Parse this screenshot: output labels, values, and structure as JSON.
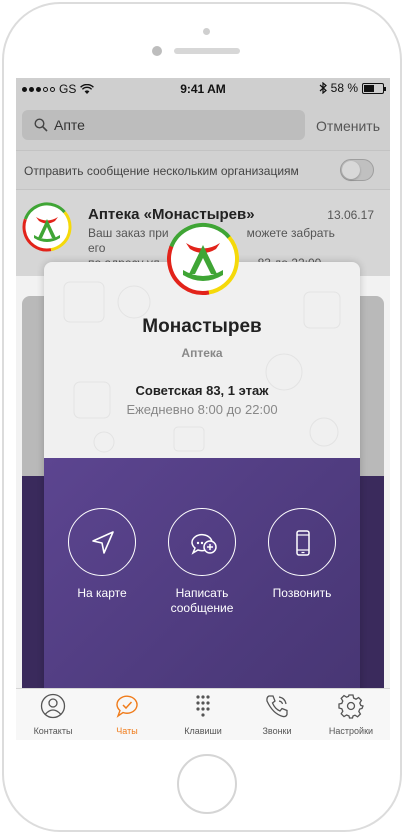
{
  "status_bar": {
    "carrier": "GS",
    "time": "9:41 AM",
    "battery": "58 %",
    "battery_level": 0.58
  },
  "search": {
    "value": "Апте",
    "cancel_label": "Отменить"
  },
  "broadcast": {
    "label": "Отправить сообщение нескольким организациям",
    "enabled": false
  },
  "chat": {
    "name": "Аптека «Монастырев»",
    "date": "13.06.17",
    "preview_line1": "Ваш заказ при",
    "preview_line1_end": "можете забрать его",
    "preview_line2": "по адресу ул",
    "preview_line2_end": "83 до 22:00..."
  },
  "card": {
    "title": "Монастырев",
    "subtitle": "Аптека",
    "address": "Советская 83, 1 этаж",
    "hours": "Ежедневно 8:00 до 22:00",
    "actions": [
      {
        "label": "На карте",
        "icon": "navigation-arrow-icon"
      },
      {
        "label": "Написать сообщение",
        "label_line1": "Написать",
        "label_line2": "сообщение",
        "icon": "chat-add-icon"
      },
      {
        "label": "Позвонить",
        "icon": "mobile-phone-icon"
      }
    ]
  },
  "tabbar": {
    "items": [
      {
        "label": "Контакты",
        "icon": "person-icon",
        "active": false
      },
      {
        "label": "Чаты",
        "icon": "chat-check-icon",
        "active": true
      },
      {
        "label": "Клавиши",
        "icon": "keypad-icon",
        "active": false
      },
      {
        "label": "Звонки",
        "icon": "phone-icon",
        "active": false
      },
      {
        "label": "Настройки",
        "icon": "gear-icon",
        "active": false
      }
    ]
  },
  "colors": {
    "accent": "#f07c1b",
    "card_purple": "#5c4590",
    "logo_green": "#3fa535",
    "logo_red": "#e2231a",
    "logo_yellow": "#f5d90a"
  }
}
